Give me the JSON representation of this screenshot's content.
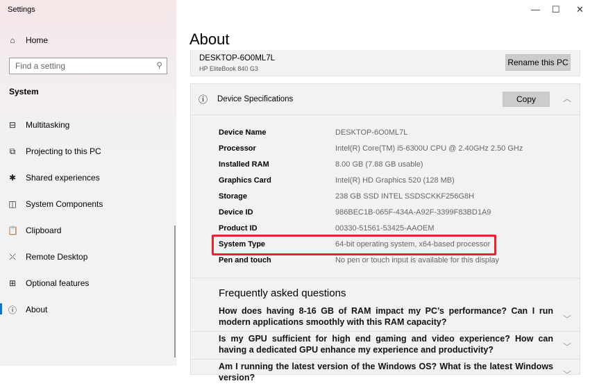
{
  "app_title": "Settings",
  "window_controls": {
    "minimize": "—",
    "maximize": "☐",
    "close": "✕"
  },
  "sidebar": {
    "home": "Home",
    "search_placeholder": "Find a setting",
    "section": "System",
    "items": [
      {
        "label": "Multitasking",
        "icon": "multitasking-icon",
        "glyph": "⊟"
      },
      {
        "label": "Projecting to this PC",
        "icon": "projecting-icon",
        "glyph": "⧉"
      },
      {
        "label": "Shared experiences",
        "icon": "shared-experiences-icon",
        "glyph": "✱"
      },
      {
        "label": "System Components",
        "icon": "system-components-icon",
        "glyph": "◫"
      },
      {
        "label": "Clipboard",
        "icon": "clipboard-icon",
        "glyph": "📋"
      },
      {
        "label": "Remote Desktop",
        "icon": "remote-desktop-icon",
        "glyph": "⤫"
      },
      {
        "label": "Optional features",
        "icon": "optional-features-icon",
        "glyph": "⊞"
      },
      {
        "label": "About",
        "icon": "info-icon",
        "glyph": "ⓘ"
      }
    ]
  },
  "main": {
    "title": "About",
    "pc_name": "DESKTOP-6O0ML7L",
    "pc_model": "HP EliteBook 840 G3",
    "rename_label": "Rename this PC",
    "specs_title": "Device Specifications",
    "copy_label": "Copy",
    "specs": [
      {
        "k": "Device Name",
        "v": "DESKTOP-6O0ML7L"
      },
      {
        "k": "Processor",
        "v": "Intel(R) Core(TM) i5-6300U CPU @ 2.40GHz   2.50 GHz"
      },
      {
        "k": "Installed RAM",
        "v": "8.00 GB (7.88 GB usable)"
      },
      {
        "k": "Graphics Card",
        "v": "Intel(R) HD Graphics 520 (128 MB)"
      },
      {
        "k": "Storage",
        "v": "238 GB SSD INTEL SSDSCKKF256G8H"
      },
      {
        "k": "Device ID",
        "v": "986BEC1B-065F-434A-A92F-3399F83BD1A9"
      },
      {
        "k": "Product ID",
        "v": "00330-51561-53425-AAOEM"
      },
      {
        "k": "System Type",
        "v": "64-bit operating system, x64-based processor"
      },
      {
        "k": "Pen and touch",
        "v": "No pen or touch input is available for this display"
      }
    ],
    "faq_title": "Frequently asked questions",
    "faqs": [
      "How does having 8-16 GB of RAM impact my PC’s performance? Can I run modern applications smoothly with this RAM capacity?",
      "Is my GPU sufficient for high end gaming and video experience? How can having a dedicated GPU enhance my experience and productivity?",
      "Am I running the latest version of the Windows OS? What is the latest Windows version?"
    ],
    "highlight_color": "#e3262f"
  }
}
